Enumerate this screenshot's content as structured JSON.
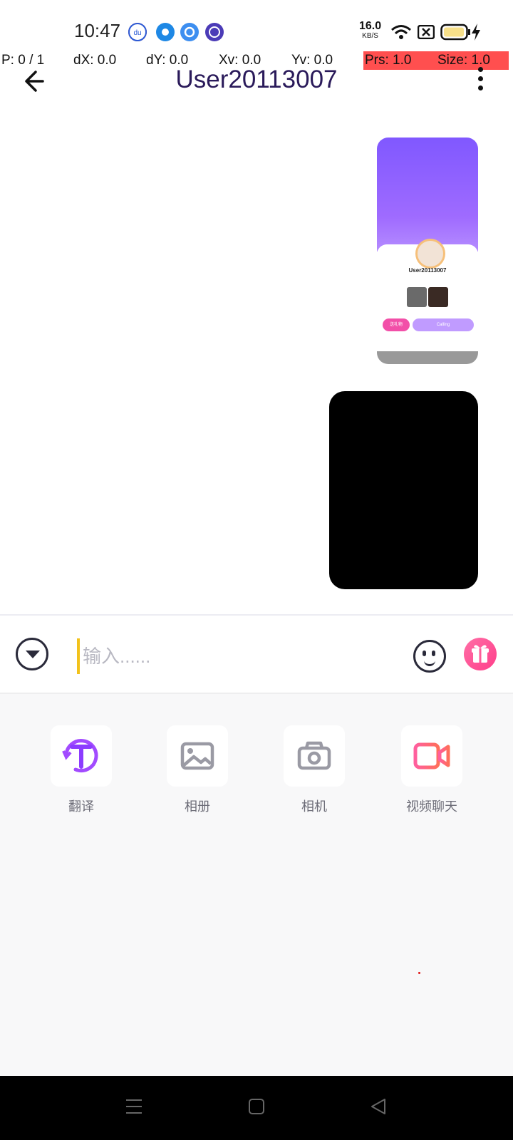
{
  "status_bar": {
    "time": "10:47",
    "net_speed_value": "16.0",
    "net_speed_unit": "KB/S",
    "app_icons": [
      "baidu-icon",
      "app-blue-circle-icon",
      "app-search-icon",
      "app-purple-circle-icon"
    ],
    "system_icons": [
      "wifi-icon",
      "no-sim-icon",
      "battery-low-icon",
      "charging-icon"
    ]
  },
  "debug_overlay": {
    "pointer": "P: 0 / 1",
    "dx": "dX: 0.0",
    "dy": "dY: 0.0",
    "xv": "Xv: 0.0",
    "yv": "Yv: 0.0",
    "prs": "Prs: 1.0",
    "size": "Size: 1.0",
    "highlight_color": "#ff4f4f"
  },
  "header": {
    "title": "User20113007",
    "back_icon": "arrow-left-icon",
    "menu_icon": "more-vertical-icon"
  },
  "messages": [
    {
      "type": "image",
      "thumbnail": {
        "name": "User20113007",
        "button_gift": "送礼物",
        "button_call": "Calling"
      }
    },
    {
      "type": "video"
    }
  ],
  "composer": {
    "placeholder": "输入......",
    "value": "",
    "collapse_icon": "chevron-down-circle-icon",
    "emoji_icon": "smiley-icon",
    "gift_icon": "gift-icon",
    "cursor_color": "#f2c21b"
  },
  "tools": [
    {
      "label": "翻译",
      "icon": "translate-icon",
      "color": "#a24bff"
    },
    {
      "label": "相册",
      "icon": "image-icon",
      "color": "#9a9aa4"
    },
    {
      "label": "相机",
      "icon": "camera-icon",
      "color": "#9a9aa4"
    },
    {
      "label": "视频聊天",
      "icon": "video-camera-icon",
      "color": "#ff5f7a"
    }
  ],
  "nav_bar": {
    "icons": [
      "menu-icon",
      "home-icon",
      "back-triangle-icon"
    ]
  },
  "colors": {
    "accent_purple": "#8c5cff",
    "gift_pink": "#ff3e8a",
    "title_color": "#2a1a5a"
  }
}
